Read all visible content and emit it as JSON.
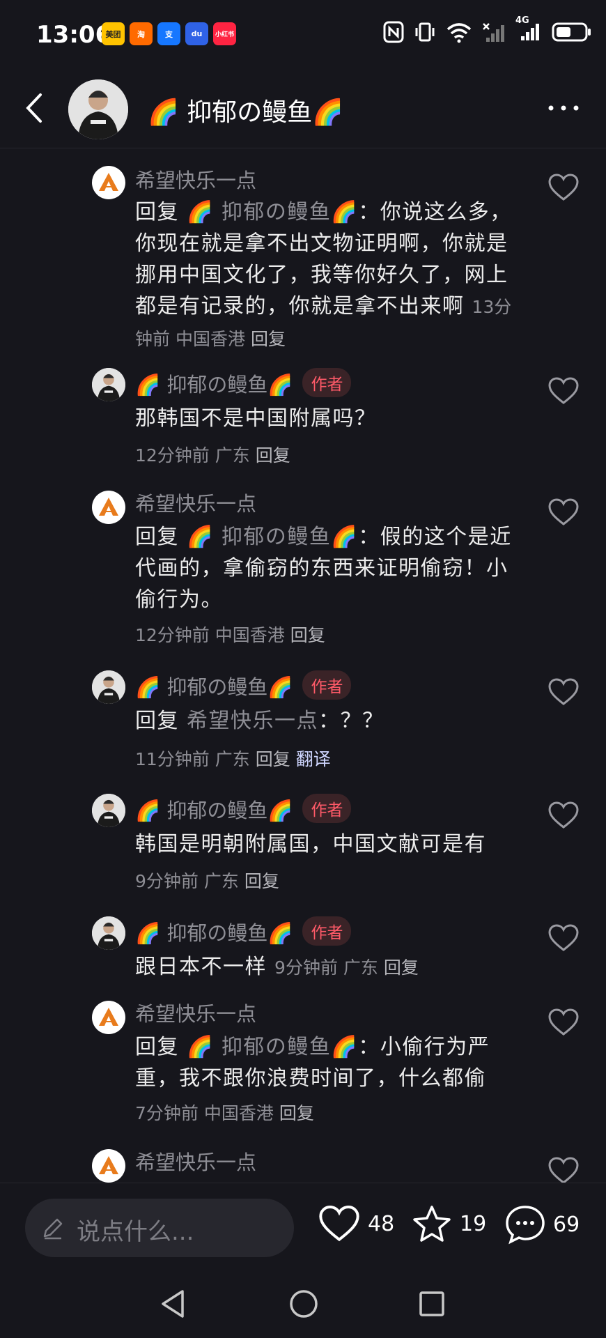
{
  "status_bar": {
    "time": "13:06",
    "app_icons": [
      {
        "label": "美团",
        "color": "#ffc300",
        "text_color": "#222"
      },
      {
        "label": "淘",
        "color": "#ff6a00",
        "text_color": "#fff"
      },
      {
        "label": "支",
        "color": "#1677ff",
        "text_color": "#fff"
      },
      {
        "label": "du",
        "color": "#2f62e6",
        "text_color": "#fff"
      },
      {
        "label": "小红书",
        "color": "#ff2442",
        "text_color": "#fff"
      }
    ],
    "network": "4G"
  },
  "header": {
    "title": "🌈 抑郁の鳗鱼🌈"
  },
  "comments": [
    {
      "author": "希望快乐一点",
      "is_author": false,
      "reply_prefix": "回复 ",
      "reply_to": "🌈 抑郁の鳗鱼🌈",
      "text": "：你说这么多，你现在就是拿不出文物证明啊，你就是挪用中国文化了，我等你好久了，网上都是有记录的，你就是拿不出来啊",
      "time": "13分钟前",
      "location": "中国香港",
      "reply_label": "回复"
    },
    {
      "author": "🌈 抑郁の鳗鱼🌈",
      "is_author": true,
      "badge": "作者",
      "text": "那韩国不是中国附属吗？",
      "time": "12分钟前",
      "location": "广东",
      "reply_label": "回复"
    },
    {
      "author": "希望快乐一点",
      "is_author": false,
      "reply_prefix": "回复 ",
      "reply_to": "🌈 抑郁の鳗鱼🌈",
      "text": "：假的这个是近代画的，拿偷窃的东西来证明偷窃！小偷行为。",
      "time": "12分钟前",
      "location": "中国香港",
      "reply_label": "回复"
    },
    {
      "author": "🌈 抑郁の鳗鱼🌈",
      "is_author": true,
      "badge": "作者",
      "reply_prefix": "回复 ",
      "reply_to": "希望快乐一点",
      "text": "：？？",
      "time": "11分钟前",
      "location": "广东",
      "reply_label": "回复",
      "translate_label": "翻译"
    },
    {
      "author": "🌈 抑郁の鳗鱼🌈",
      "is_author": true,
      "badge": "作者",
      "text": "韩国是明朝附属国，中国文献可是有",
      "time": "9分钟前",
      "location": "广东",
      "reply_label": "回复"
    },
    {
      "author": "🌈 抑郁の鳗鱼🌈",
      "is_author": true,
      "badge": "作者",
      "text": "跟日本不一样",
      "time": "9分钟前",
      "location": "广东",
      "reply_label": "回复"
    },
    {
      "author": "希望快乐一点",
      "is_author": false,
      "reply_prefix": "回复 ",
      "reply_to": "🌈 抑郁の鳗鱼🌈",
      "text": "：小偷行为严重，我不跟你浪费时间了，什么都偷",
      "time": "7分钟前",
      "location": "中国香港",
      "reply_label": "回复"
    },
    {
      "author": "希望快乐一点",
      "is_author": false
    }
  ],
  "bottom_bar": {
    "input_placeholder": "说点什么...",
    "likes": "48",
    "favorites": "19",
    "comments": "69"
  }
}
